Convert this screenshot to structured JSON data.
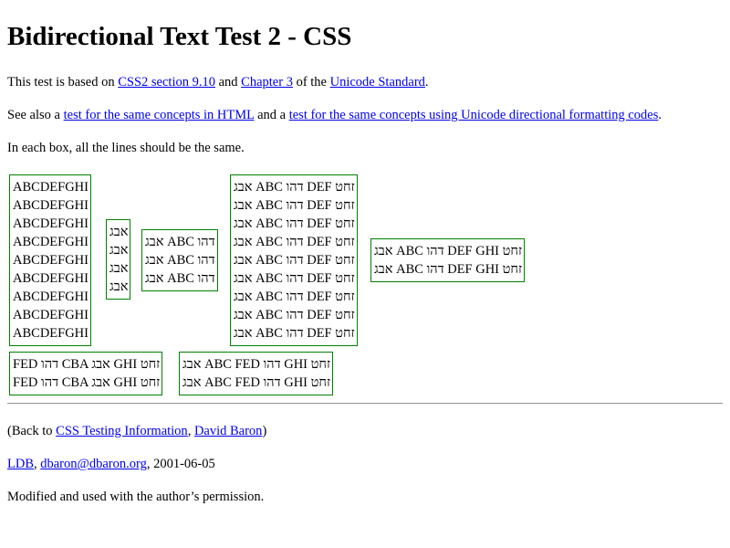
{
  "title": "Bidirectional Text Test 2 - CSS",
  "intro": {
    "prefix": "This test is based on ",
    "link1": "CSS2 section 9.10",
    "mid1": " and ",
    "link2": "Chapter 3",
    "mid2": " of the ",
    "link3": "Unicode Standard",
    "suffix": "."
  },
  "see_also": {
    "prefix": "See also a ",
    "link1": "test for the same concepts in HTML",
    "mid": " and a ",
    "link2": "test for the same concepts using Unicode directional formatting codes",
    "suffix": "."
  },
  "instruction": "In each box, all the lines should be the same.",
  "boxes": {
    "box1": {
      "lines": [
        "ABCDEFGHI",
        "ABCDEFGHI",
        "ABCDEFGHI",
        "ABCDEFGHI",
        "ABCDEFGHI",
        "ABCDEFGHI",
        "ABCDEFGHI",
        "ABCDEFGHI",
        "ABCDEFGHI"
      ]
    },
    "box2": {
      "lines": [
        "אבג",
        "אבג",
        "אבג",
        "אבג"
      ]
    },
    "box3": {
      "lines": [
        "אבג ABC דהו",
        "אבג ABC דהו",
        "אבג ABC דהו"
      ]
    },
    "box4": {
      "lines": [
        "אבג ABC דהו DEF זחט",
        "אבג ABC דהו DEF זחט",
        "אבג ABC דהו DEF זחט",
        "אבג ABC דהו DEF זחט",
        "אבג ABC דהו DEF זחט",
        "אבג ABC דהו DEF זחט",
        "אבג ABC דהו DEF זחט",
        "אבג ABC דהו DEF זחט",
        "אבג ABC דהו DEF זחט"
      ]
    },
    "box5": {
      "lines": [
        "אבג ABC דהו DEF GHI זחט",
        "אבג ABC דהו DEF GHI זחט"
      ]
    },
    "box6": {
      "lines": [
        "FED דהו CBA אבג GHI זחט",
        "FED דהו CBA אבג GHI זחט"
      ]
    },
    "box7": {
      "lines": [
        "אבג ABC FED דהו GHI זחט",
        "אבג ABC FED דהו GHI זחט"
      ]
    }
  },
  "back": {
    "prefix": "(Back to ",
    "link1": "CSS Testing Information",
    "mid": ", ",
    "link2": "David Baron",
    "suffix": ")"
  },
  "author": {
    "link1": "LDB",
    "mid": ", ",
    "link2": "dbaron@dbaron.org",
    "suffix": ", 2001-06-05"
  },
  "permission": "Modified and used with the author’s permission."
}
